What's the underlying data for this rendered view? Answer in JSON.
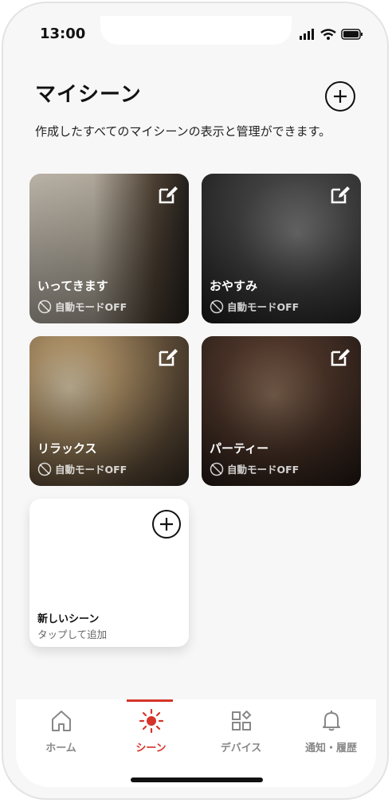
{
  "status": {
    "time": "13:00"
  },
  "header": {
    "title": "マイシーン",
    "description": "作成したすべてのマイシーンの表示と管理ができます。"
  },
  "scenes": [
    {
      "name": "いってきます",
      "mode": "自動モードOFF"
    },
    {
      "name": "おやすみ",
      "mode": "自動モードOFF"
    },
    {
      "name": "リラックス",
      "mode": "自動モードOFF"
    },
    {
      "name": "パーティー",
      "mode": "自動モードOFF"
    }
  ],
  "new_scene": {
    "title": "新しいシーン",
    "subtitle": "タップして追加"
  },
  "tabs": [
    {
      "label": "ホーム",
      "icon": "home-icon"
    },
    {
      "label": "シーン",
      "icon": "sun-icon",
      "active": true
    },
    {
      "label": "デバイス",
      "icon": "devices-icon"
    },
    {
      "label": "通知・履歴",
      "icon": "bell-icon"
    }
  ],
  "colors": {
    "accent": "#d6342a",
    "background": "#f7f7f7"
  }
}
